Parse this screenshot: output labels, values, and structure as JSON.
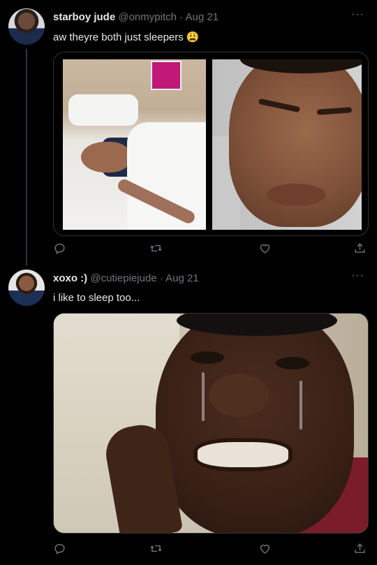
{
  "tweets": [
    {
      "display_name": "starboy jude",
      "handle": "@onmypitch",
      "date": "Aug 21",
      "separator": "·",
      "text": "aw theyre both just sleepers 😩",
      "more": "···"
    },
    {
      "display_name": "xoxo :)",
      "handle": "@cutiepiejude",
      "date": "Aug 21",
      "separator": "·",
      "text": "i like to sleep too...",
      "more": "···"
    }
  ],
  "actions": {
    "reply_icon": "reply-icon",
    "retweet_icon": "retweet-icon",
    "like_icon": "like-icon",
    "share_icon": "share-icon"
  },
  "colors": {
    "background": "#000000",
    "text": "#e7e9ea",
    "secondary": "#71767b",
    "border": "#2f3336"
  }
}
